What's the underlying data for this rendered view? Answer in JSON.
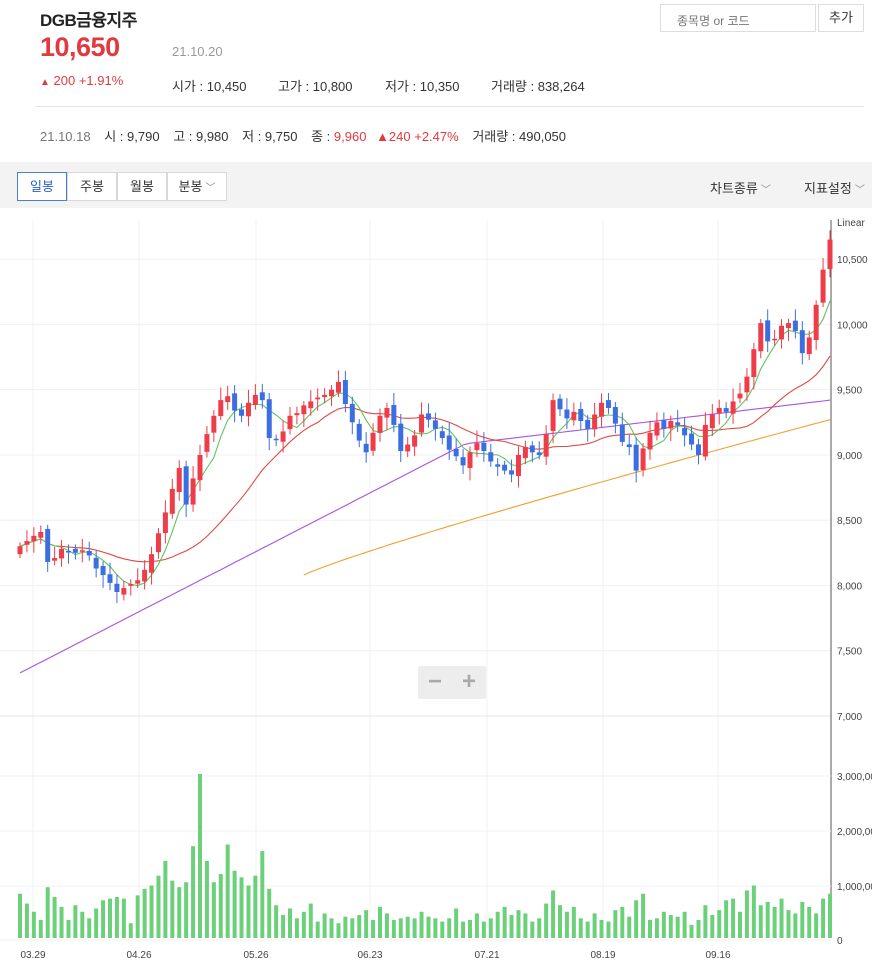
{
  "header": {
    "stock_name": "DGB금융지주",
    "price": "10,650",
    "date": "21.10.20",
    "change_arrow": "▲",
    "change": "200 +1.91%",
    "open": "시가 : 10,450",
    "high": "고가 : 10,800",
    "low": "저가 : 10,350",
    "volume": "거래량 : 838,264"
  },
  "search": {
    "placeholder": "종목명 or 코드",
    "add_label": "추가"
  },
  "previous_day": {
    "date": "21.10.18",
    "open": "시 : 9,790",
    "high": "고 : 9,980",
    "low": "저 : 9,750",
    "close_label": "종 : ",
    "close_value": "9,960",
    "change": "▲240 +2.47%",
    "volume": "거래량 : 490,050"
  },
  "toolbar": {
    "period_tabs": [
      "일봉",
      "주봉",
      "월봉",
      "분봉"
    ],
    "active_tab": "일봉",
    "chart_type_label": "차트종류",
    "indicator_label": "지표설정"
  },
  "zoom": {
    "minus": "−",
    "plus": "+"
  },
  "colors": {
    "up": "#ee3c48",
    "down": "#3b6ee0",
    "ma5": "#62c462",
    "ma20": "#e04a44",
    "ma60": "#a855e0",
    "ma120": "#f0a030",
    "volume": "#6cd07a"
  },
  "chart_data": {
    "type": "candlestick",
    "scale_label": "Linear",
    "price_axis": {
      "min": 7000,
      "max": 10800,
      "ticks": [
        "10,500",
        "10,000",
        "9,500",
        "9,000",
        "8,500",
        "8,000",
        "7,500",
        "7,000"
      ]
    },
    "volume_axis": {
      "ticks": [
        "3,000,00",
        "2,000,00",
        "1,000,00",
        "0"
      ]
    },
    "x_labels": [
      "03.29",
      "04.26",
      "05.26",
      "06.23",
      "07.21",
      "08.19",
      "09.16"
    ],
    "series": [
      "MA5",
      "MA20",
      "MA60",
      "MA120"
    ],
    "close": [
      8300,
      8340,
      8380,
      8410,
      8180,
      8210,
      8280,
      8260,
      8250,
      8270,
      8230,
      8130,
      8080,
      8020,
      7950,
      7980,
      8010,
      8040,
      8120,
      8240,
      8400,
      8560,
      8740,
      8900,
      8620,
      8820,
      9000,
      9160,
      9300,
      9420,
      9450,
      9340,
      9300,
      9400,
      9460,
      9420,
      9130,
      9120,
      9180,
      9300,
      9320,
      9380,
      9410,
      9440,
      9460,
      9500,
      9560,
      9390,
      9250,
      9110,
      9020,
      9170,
      9300,
      9360,
      9230,
      9030,
      9080,
      9150,
      9310,
      9270,
      9200,
      9130,
      9040,
      8990,
      8920,
      9020,
      9090,
      9030,
      8950,
      8910,
      8880,
      8850,
      9000,
      9060,
      9020,
      9000,
      9160,
      9420,
      9350,
      9280,
      9330,
      9260,
      9200,
      9310,
      9400,
      9360,
      9240,
      9100,
      9060,
      8880,
      9050,
      9170,
      9250,
      9200,
      9260,
      9230,
      9150,
      9080,
      9000,
      9230,
      9310,
      9360,
      9330,
      9410,
      9470,
      9600,
      9810,
      10010,
      9870,
      9890,
      9990,
      10010,
      9950,
      9780,
      9900,
      10150,
      10420,
      10650
    ],
    "volume_relative": [
      0.27,
      0.21,
      0.16,
      0.11,
      0.31,
      0.25,
      0.19,
      0.11,
      0.2,
      0.16,
      0.12,
      0.18,
      0.23,
      0.24,
      0.25,
      0.24,
      0.09,
      0.26,
      0.3,
      0.32,
      0.38,
      0.47,
      0.35,
      0.31,
      0.34,
      0.56,
      1.0,
      0.47,
      0.34,
      0.39,
      0.57,
      0.41,
      0.37,
      0.32,
      0.38,
      0.53,
      0.3,
      0.2,
      0.14,
      0.18,
      0.12,
      0.16,
      0.21,
      0.1,
      0.15,
      0.12,
      0.09,
      0.13,
      0.12,
      0.14,
      0.17,
      0.11,
      0.19,
      0.15,
      0.11,
      0.12,
      0.13,
      0.12,
      0.16,
      0.13,
      0.12,
      0.1,
      0.12,
      0.18,
      0.1,
      0.11,
      0.15,
      0.1,
      0.12,
      0.16,
      0.19,
      0.14,
      0.17,
      0.15,
      0.1,
      0.12,
      0.21,
      0.29,
      0.2,
      0.16,
      0.19,
      0.12,
      0.1,
      0.15,
      0.11,
      0.1,
      0.17,
      0.19,
      0.13,
      0.23,
      0.27,
      0.11,
      0.12,
      0.16,
      0.14,
      0.13,
      0.16,
      0.08,
      0.11,
      0.2,
      0.14,
      0.17,
      0.23,
      0.24,
      0.16,
      0.29,
      0.32,
      0.2,
      0.22,
      0.19,
      0.24,
      0.17,
      0.15,
      0.22,
      0.19,
      0.15,
      0.24,
      0.27
    ]
  }
}
